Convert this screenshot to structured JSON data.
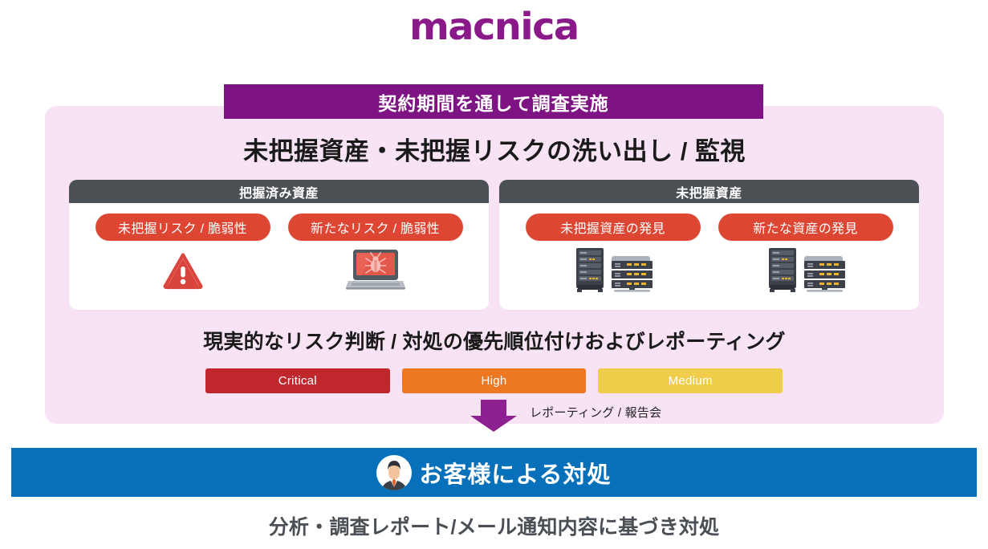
{
  "logo": {
    "text": "macnica",
    "color": "#8A1A8A"
  },
  "banner": {
    "title": "契約期間を通して調査実施",
    "bg_color": "#7E1384"
  },
  "heading": "未把握資産・未把握リスクの洗い出し / 監視",
  "cards": [
    {
      "id": "known-assets",
      "header": "把握済み資産",
      "pills": [
        {
          "label": "未把握リスク / 脆弱性",
          "icon": "warning-triangle-icon"
        },
        {
          "label": "新たなリスク / 脆弱性",
          "icon": "laptop-bug-icon"
        }
      ]
    },
    {
      "id": "unknown-assets",
      "header": "未把握資産",
      "pills": [
        {
          "label": "未把握資産の発見",
          "icon": "server-rack-icon"
        },
        {
          "label": "新たな資産の発見",
          "icon": "server-rack-icon"
        }
      ]
    }
  ],
  "risk_line": "現実的なリスク判断 / 対処の優先順位付けおよびレポーティング",
  "severity": [
    {
      "label": "Critical",
      "color": "#C0272D"
    },
    {
      "label": "High",
      "color": "#EE7722"
    },
    {
      "label": "Medium",
      "color": "#F0CE4C"
    }
  ],
  "reporting": {
    "label": "レポーティング / 報告会",
    "arrow_color": "#8E2191"
  },
  "customer_banner": {
    "text": "お客様による対処",
    "bg_color": "#0770BA",
    "avatar": "businessman-avatar-icon"
  },
  "bottom_caption": "分析・調査レポート/メール通知内容に基づき対処",
  "colors": {
    "pink_panel": "#F8E3F5",
    "card_header": "#4B5055",
    "pill": "#DC4633"
  }
}
